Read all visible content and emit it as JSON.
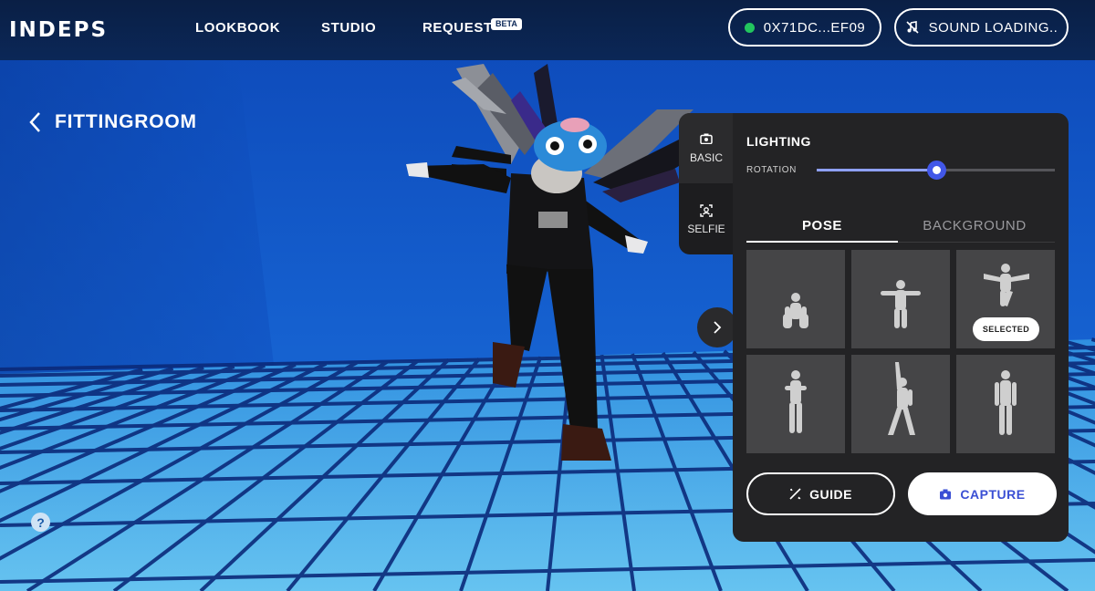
{
  "header": {
    "logo": "INDEPS",
    "nav": [
      {
        "label": "LOOKBOOK"
      },
      {
        "label": "STUDIO"
      },
      {
        "label": "REQUEST",
        "badge": "BETA"
      }
    ],
    "wallet": {
      "address": "0X71DC...EF09",
      "status_color": "#22c55e"
    },
    "sound": {
      "label": "SOUND LOADING.."
    }
  },
  "page": {
    "title": "FITTINGROOM",
    "help_label": "?"
  },
  "side_tabs": [
    {
      "label": "BASIC",
      "icon": "camera-icon",
      "active": true
    },
    {
      "label": "SELFIE",
      "icon": "selfie-icon",
      "active": false
    }
  ],
  "panel": {
    "lighting_label": "LIGHTING",
    "rotation_label": "ROTATION",
    "rotation_value": 0.5,
    "tabs": [
      {
        "label": "POSE",
        "active": true
      },
      {
        "label": "BACKGROUND",
        "active": false
      }
    ],
    "poses": [
      {
        "name": "crouch",
        "selected": false
      },
      {
        "name": "t-pose",
        "selected": false
      },
      {
        "name": "airplane",
        "selected": true
      },
      {
        "name": "hands-clasped",
        "selected": false
      },
      {
        "name": "arm-raised",
        "selected": false
      },
      {
        "name": "standing",
        "selected": false
      }
    ],
    "selected_label": "SELECTED",
    "guide_label": "GUIDE",
    "capture_label": "CAPTURE"
  },
  "colors": {
    "accent": "#4257e8",
    "capture_text": "#3a4fd4",
    "header_bg": "#0b2757",
    "panel_bg": "#232325"
  }
}
